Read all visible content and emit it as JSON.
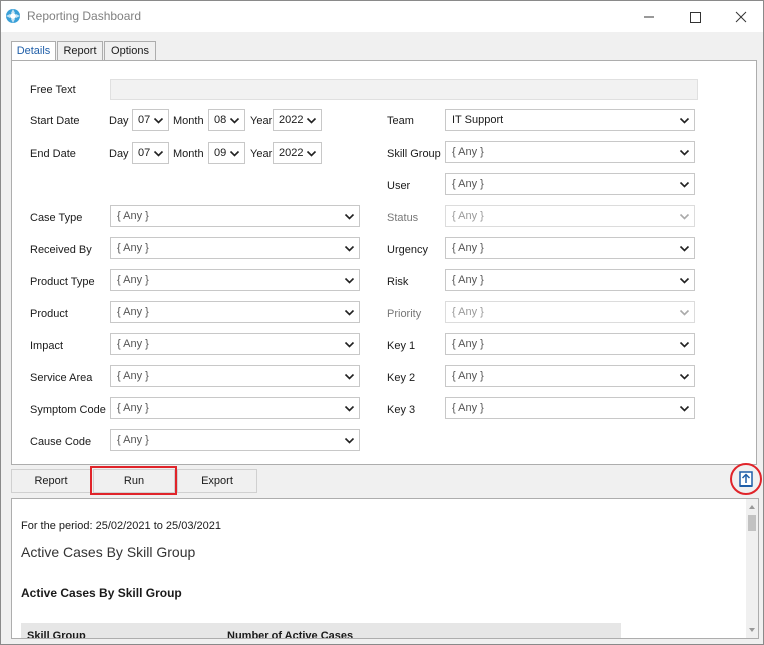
{
  "window": {
    "title": "Reporting Dashboard"
  },
  "tabs": [
    {
      "label": "Details"
    },
    {
      "label": "Report"
    },
    {
      "label": "Options"
    }
  ],
  "form": {
    "free_text_label": "Free Text",
    "free_text_value": "",
    "start_date": {
      "label": "Start Date",
      "day_label": "Day",
      "day": "07",
      "month_label": "Month",
      "month": "08",
      "year_label": "Year",
      "year": "2022"
    },
    "end_date": {
      "label": "End Date",
      "day_label": "Day",
      "day": "07",
      "month_label": "Month",
      "month": "09",
      "year_label": "Year",
      "year": "2022"
    },
    "left_fields": [
      {
        "label": "Case Type",
        "value": "{ Any }"
      },
      {
        "label": "Received By",
        "value": "{ Any }"
      },
      {
        "label": "Product Type",
        "value": "{ Any }"
      },
      {
        "label": "Product",
        "value": "{ Any }"
      },
      {
        "label": "Impact",
        "value": "{ Any }"
      },
      {
        "label": "Service Area",
        "value": "{ Any }"
      },
      {
        "label": "Symptom Code",
        "value": "{ Any }"
      },
      {
        "label": "Cause Code",
        "value": "{ Any }"
      }
    ],
    "right_fields": [
      {
        "label": "Team",
        "value": "IT Support"
      },
      {
        "label": "Skill Group",
        "value": "{ Any }"
      },
      {
        "label": "User",
        "value": "{ Any }"
      },
      {
        "label": "Status",
        "value": "{ Any }"
      },
      {
        "label": "Urgency",
        "value": "{ Any }"
      },
      {
        "label": "Risk",
        "value": "{ Any }"
      },
      {
        "label": "Priority",
        "value": "{ Any }"
      },
      {
        "label": "Key 1",
        "value": "{ Any }"
      },
      {
        "label": "Key 2",
        "value": "{ Any }"
      },
      {
        "label": "Key 3",
        "value": "{ Any }"
      }
    ]
  },
  "buttons": {
    "report": "Report",
    "run": "Run",
    "export": "Export"
  },
  "output": {
    "period": "For the period: 25/02/2021 to 25/03/2021",
    "heading": "Active Cases By Skill Group",
    "subheading": "Active Cases By Skill Group",
    "table_headers": [
      "Skill Group",
      "Number of Active Cases"
    ]
  },
  "colors": {
    "accent": "#1f5ea8",
    "highlight": "#e0242a"
  }
}
